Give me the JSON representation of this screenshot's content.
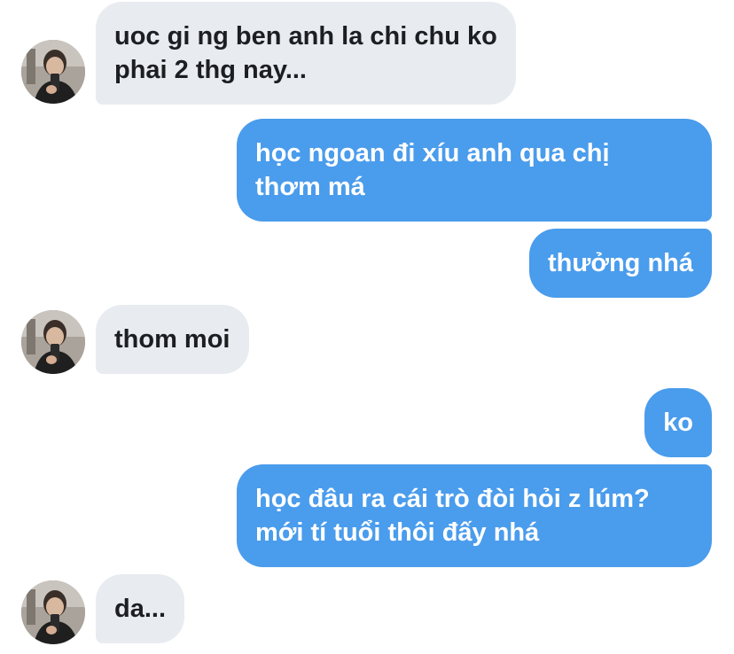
{
  "colors": {
    "incoming_bubble": "#e8ebef",
    "outgoing_bubble": "#4a9cec",
    "incoming_text": "#1c1e21",
    "outgoing_text": "#ffffff"
  },
  "messages": [
    {
      "from": "contact",
      "lines": [
        "uoc gi ng ben anh la chi chu ko",
        "phai 2 thg nay..."
      ]
    },
    {
      "from": "me",
      "lines": [
        "học ngoan đi xíu anh qua chị",
        "thơm má"
      ]
    },
    {
      "from": "me",
      "lines": [
        "thưởng nhá"
      ]
    },
    {
      "from": "contact",
      "lines": [
        "thom moi"
      ]
    },
    {
      "from": "me",
      "lines": [
        "ko"
      ]
    },
    {
      "from": "me",
      "lines": [
        "học đâu ra cái trò đòi hỏi z lúm?",
        "mới tí tuổi thôi đấy nhá"
      ]
    },
    {
      "from": "contact",
      "lines": [
        "da..."
      ]
    }
  ],
  "contact_avatar_icon": "contact-avatar-photo"
}
